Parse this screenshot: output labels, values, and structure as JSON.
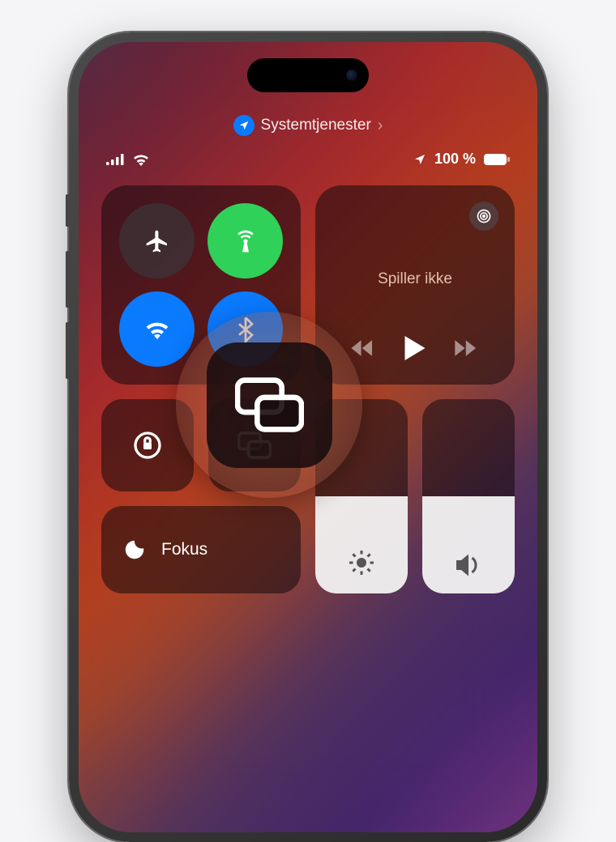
{
  "header": {
    "system_services": "Systemtjenester"
  },
  "status": {
    "battery_percent": "100 %"
  },
  "media": {
    "not_playing": "Spiller ikke"
  },
  "focus": {
    "label": "Fokus"
  },
  "icons": {
    "location": "location-arrow",
    "airplane": "airplane-icon",
    "cellular": "cellular-antenna-icon",
    "wifi": "wifi-icon",
    "bluetooth": "bluetooth-icon",
    "airplay": "airplay-icon",
    "rewind": "rewind-icon",
    "play": "play-icon",
    "forward": "forward-icon",
    "lock_rotation": "rotation-lock-icon",
    "screen_mirroring": "screen-mirroring-icon",
    "moon": "moon-icon",
    "brightness": "brightness-icon",
    "volume": "volume-icon"
  }
}
